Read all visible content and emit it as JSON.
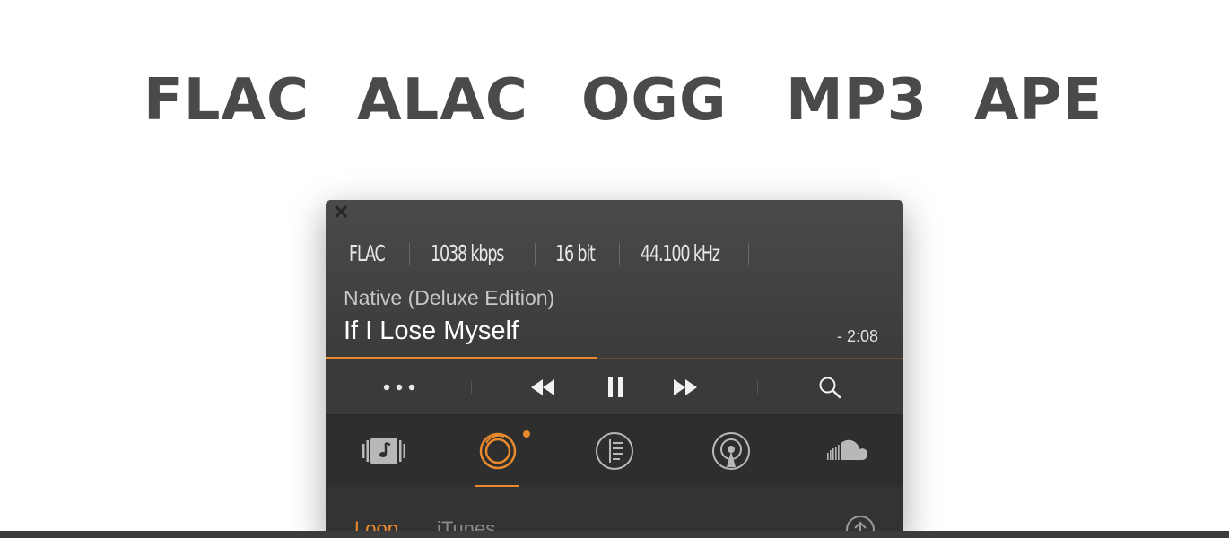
{
  "formats": [
    "FLAC",
    "ALAC",
    "OGG",
    "MP3",
    "APE"
  ],
  "player": {
    "specs": {
      "codec": "FLAC",
      "bitrate": "1038 kbps",
      "bit_depth": "16 bit",
      "sample_rate": "44.100 kHz"
    },
    "album": "Native (Deluxe Edition)",
    "track": "If I Lose Myself",
    "time_remaining": "- 2:08",
    "progress_fraction": 0.47,
    "tabs": [
      {
        "name": "library-icon",
        "active": false
      },
      {
        "name": "now-playing-icon",
        "active": true
      },
      {
        "name": "playlist-icon",
        "active": false
      },
      {
        "name": "radio-icon",
        "active": false
      },
      {
        "name": "soundcloud-icon",
        "active": false
      }
    ],
    "subtabs": {
      "loop": "Loop",
      "itunes": "iTunes"
    },
    "colors": {
      "accent": "#e8892e",
      "panel": "#3a3a3a"
    }
  }
}
